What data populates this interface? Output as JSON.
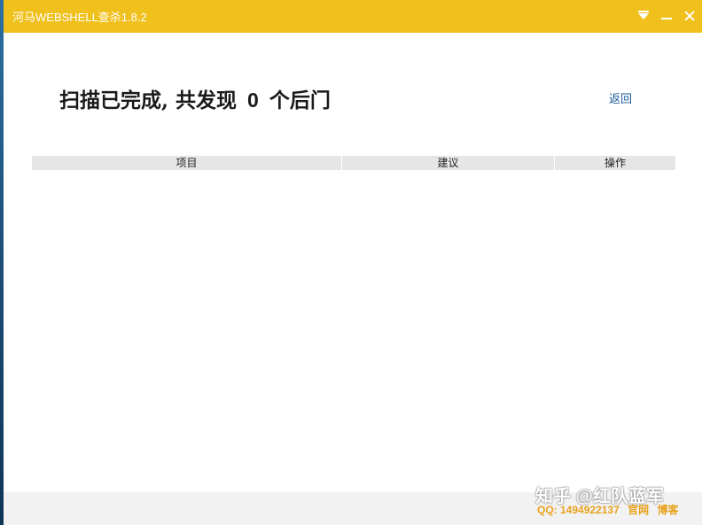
{
  "window": {
    "title": "河马WEBSHELL查杀1.8.2",
    "accent_color": "#f0c01c"
  },
  "result": {
    "headline_prefix": "扫描已完成, 共发现",
    "count": "0",
    "headline_suffix": "个后门",
    "back_label": "返回"
  },
  "table": {
    "columns": [
      "项目",
      "建议",
      "操作"
    ],
    "rows": []
  },
  "footer": {
    "watermark": "知乎 @红队蓝军",
    "qq": "QQ: 1494922137",
    "link_official": "官网",
    "link_blog": "博客"
  }
}
